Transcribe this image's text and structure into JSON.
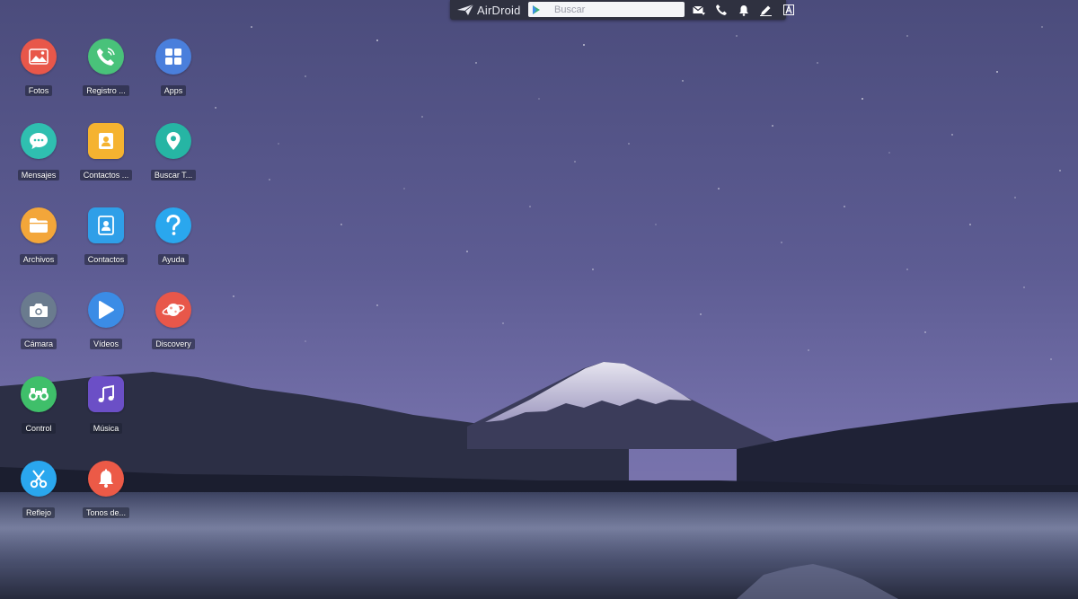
{
  "topbar": {
    "logo_text": "AirDroid",
    "search_placeholder": "Buscar",
    "icons": [
      "mail-icon",
      "phone-icon",
      "bell-icon",
      "edit-icon",
      "font-icon"
    ]
  },
  "desktop": {
    "apps": [
      {
        "label": "Fotos",
        "icon": "photos-icon",
        "color": "#e8574a"
      },
      {
        "label": "Registro ...",
        "icon": "call-log-icon",
        "color": "#49c27a"
      },
      {
        "label": "Apps",
        "icon": "apps-grid-icon",
        "color": "#4a7fdc"
      },
      {
        "label": "Mensajes",
        "icon": "messages-icon",
        "color": "#2fbfb0"
      },
      {
        "label": "Contactos ...",
        "icon": "contacts-card-icon",
        "color": "#f5b330"
      },
      {
        "label": "Buscar T...",
        "icon": "location-pin-icon",
        "color": "#26b5a4"
      },
      {
        "label": "Archivos",
        "icon": "folder-icon",
        "color": "#f3a63a"
      },
      {
        "label": "Contactos",
        "icon": "contacts-icon",
        "color": "#2f9fe8"
      },
      {
        "label": "Ayuda",
        "icon": "help-icon",
        "color": "#2aa7ee"
      },
      {
        "label": "Cámara",
        "icon": "camera-icon",
        "color": "#6a7b8e"
      },
      {
        "label": "Vídeos",
        "icon": "video-play-icon",
        "color": "#3b8ce6"
      },
      {
        "label": "Discovery",
        "icon": "planet-icon",
        "color": "#e8574a"
      },
      {
        "label": "Control",
        "icon": "binoculars-icon",
        "color": "#3fbf6a"
      },
      {
        "label": "Música",
        "icon": "music-icon",
        "color": "#6b4fc6"
      },
      {
        "label": "Reflejo",
        "icon": "scissors-icon",
        "color": "#2aa7ee"
      },
      {
        "label": "Tonos de...",
        "icon": "ringtone-bell-icon",
        "color": "#ec5a47"
      }
    ]
  }
}
